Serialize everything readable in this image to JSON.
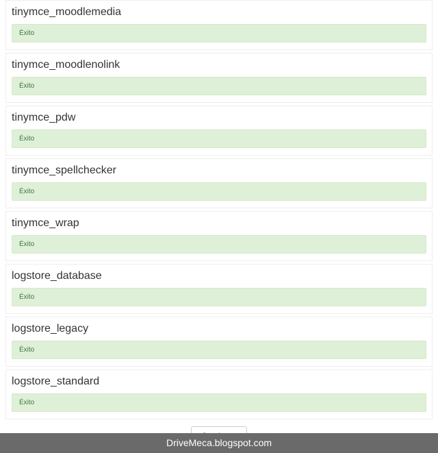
{
  "sections": [
    {
      "title": "tinymce_moodlemedia",
      "status": "Éxito"
    },
    {
      "title": "tinymce_moodlenolink",
      "status": "Éxito"
    },
    {
      "title": "tinymce_pdw",
      "status": "Éxito"
    },
    {
      "title": "tinymce_spellchecker",
      "status": "Éxito"
    },
    {
      "title": "tinymce_wrap",
      "status": "Éxito"
    },
    {
      "title": "logstore_database",
      "status": "Éxito"
    },
    {
      "title": "logstore_legacy",
      "status": "Éxito"
    },
    {
      "title": "logstore_standard",
      "status": "Éxito"
    }
  ],
  "button": {
    "label": "Continuar"
  },
  "footer": {
    "text": "DriveMeca.blogspot.com"
  }
}
